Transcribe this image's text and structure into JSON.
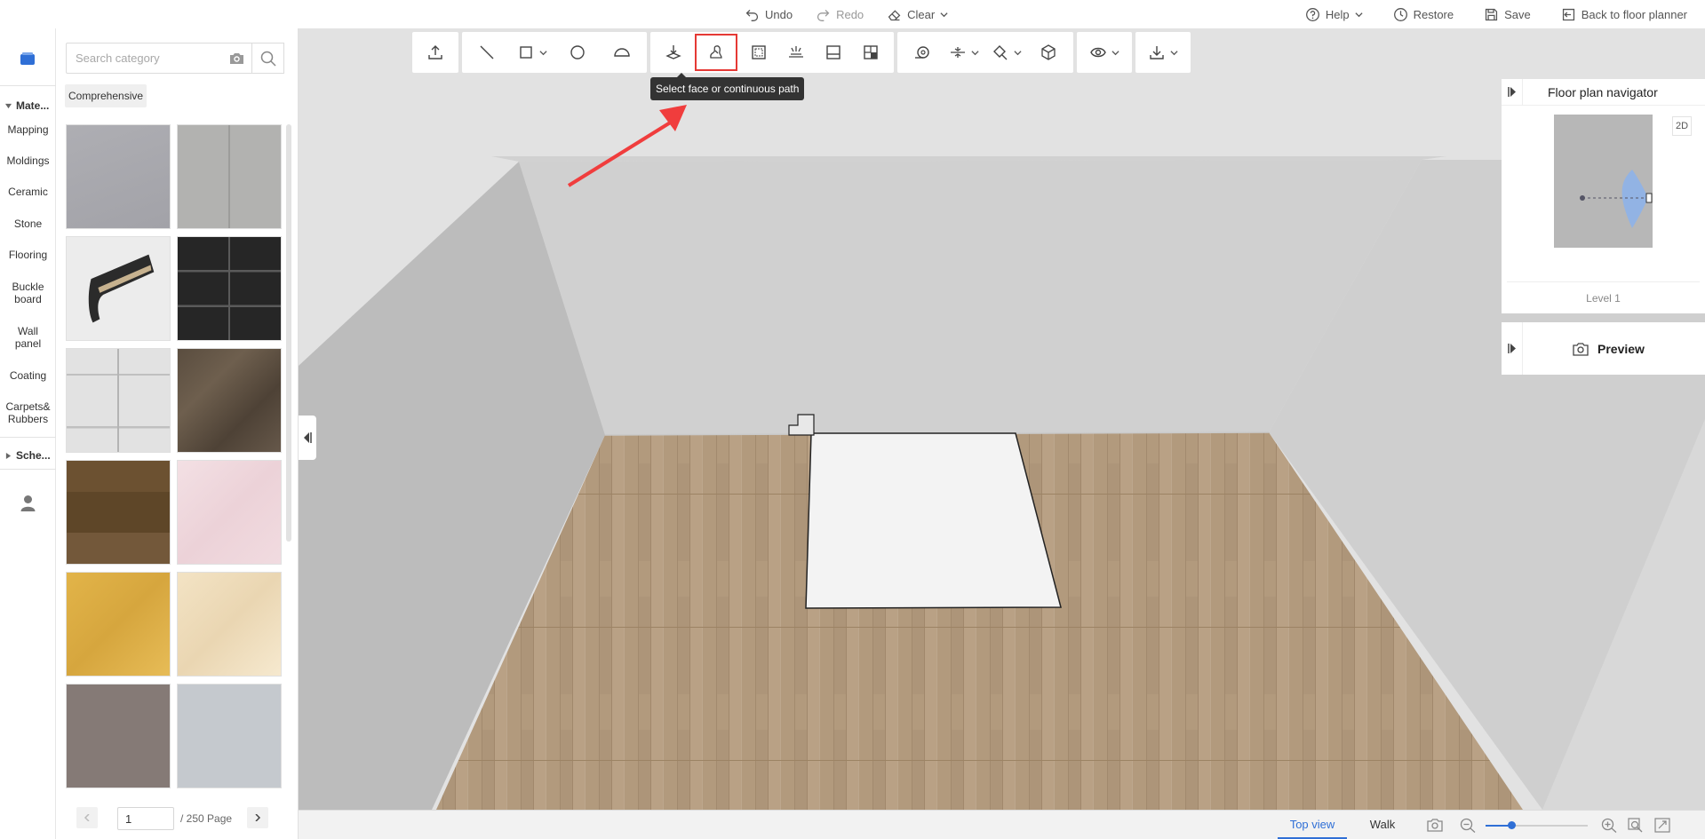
{
  "topbar": {
    "undo": "Undo",
    "redo": "Redo",
    "clear": "Clear",
    "help": "Help",
    "restore": "Restore",
    "save": "Save",
    "back": "Back to floor planner"
  },
  "rail": {
    "group_materials": "Mate...",
    "items": [
      "Mapping",
      "Moldings",
      "Ceramic",
      "Stone",
      "Flooring",
      "Buckle board",
      "Wall panel",
      "Coating",
      "Carpets& Rubbers"
    ],
    "group_schemes": "Sche..."
  },
  "panel": {
    "search_placeholder": "Search category",
    "chip": "Comprehensive",
    "page_value": "1",
    "page_total": "/ 250 Page"
  },
  "tooltip": "Select face or continuous path",
  "navigator": {
    "title": "Floor plan navigator",
    "badge": "2D",
    "level": "Level 1"
  },
  "preview": {
    "label": "Preview"
  },
  "bottombar": {
    "tab_top": "Top view",
    "tab_walk": "Walk",
    "zoom_fraction": 0.25
  },
  "colors": {
    "accent": "#2f6fd6",
    "highlight": "#e53935",
    "floor": "#b89f82"
  }
}
